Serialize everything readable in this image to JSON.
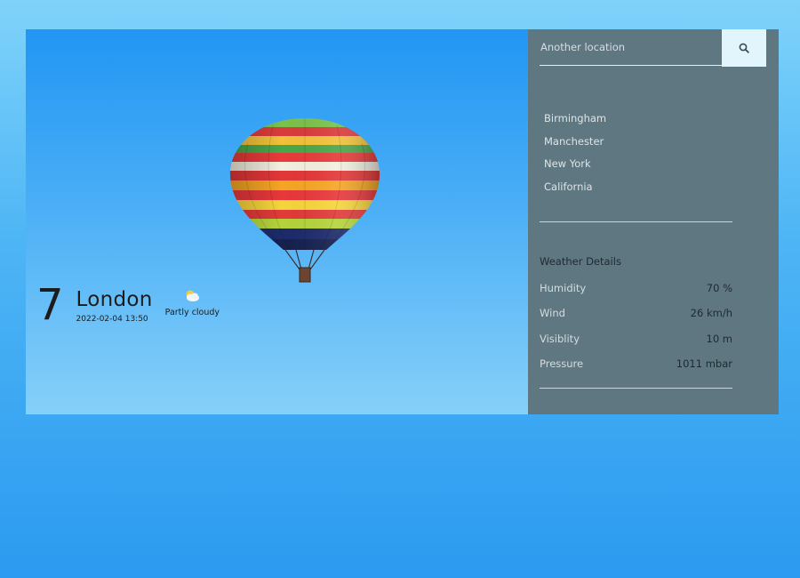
{
  "current": {
    "temperature": "7",
    "city": "London",
    "datetime": "2022-02-04 13:50",
    "condition": "Partly cloudy",
    "condition_icon": "partly-cloudy-icon"
  },
  "search": {
    "placeholder": "Another location",
    "button_icon": "search-icon"
  },
  "locations": [
    "Birmingham",
    "Manchester",
    "New York",
    "California"
  ],
  "details": {
    "title": "Weather Details",
    "rows": [
      {
        "label": "Humidity",
        "value": "70 %"
      },
      {
        "label": "Wind",
        "value": "26 km/h"
      },
      {
        "label": "Visiblity",
        "value": "10 m"
      },
      {
        "label": "Pressure",
        "value": "1011 mbar"
      }
    ]
  },
  "colors": {
    "side_panel": "#5f7780",
    "sky_top": "#2196f3",
    "sky_bottom": "#86d0f9",
    "search_button": "#e3f5fc"
  }
}
